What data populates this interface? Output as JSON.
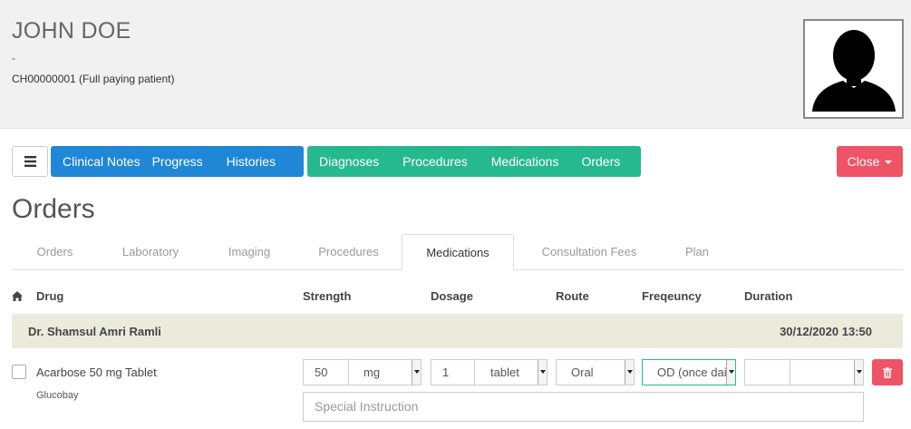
{
  "patient": {
    "name": "JOHN DOE",
    "subtitle": "-",
    "id_line": "CH00000001 (Full paying patient)"
  },
  "nav": {
    "menu_icon": "hamburger-icon",
    "blue_group": [
      "Clinical Notes",
      "Progress",
      "Histories"
    ],
    "green_group": [
      "Diagnoses",
      "Procedures",
      "Medications",
      "Orders"
    ],
    "close_label": "Close",
    "colors": {
      "blue": "#1f87d6",
      "green": "#26b98f",
      "red": "#ef5466"
    }
  },
  "page": {
    "title": "Orders"
  },
  "tabs": {
    "items": [
      "Orders",
      "Laboratory",
      "Imaging",
      "Procedures",
      "Medications",
      "Consultation Fees",
      "Plan"
    ],
    "active": "Medications"
  },
  "table": {
    "headers": {
      "index_icon": "home-icon",
      "drug": "Drug",
      "strength": "Strength",
      "dosage": "Dosage",
      "route": "Route",
      "frequency": "Freqeuncy",
      "duration": "Duration"
    },
    "group": {
      "doctor": "Dr. Shamsul Amri Ramli",
      "datetime": "30/12/2020 13:50"
    },
    "row": {
      "drug": "Acarbose 50 mg Tablet",
      "brand": "Glucobay",
      "strength_value": "50",
      "strength_unit": "mg",
      "dosage_value": "1",
      "dosage_unit": "tablet",
      "route": "Oral",
      "frequency": "OD (once daily)",
      "duration_value": "",
      "duration_unit": "",
      "instruction_placeholder": "Special Instruction",
      "delete_icon": "trash-icon"
    }
  }
}
